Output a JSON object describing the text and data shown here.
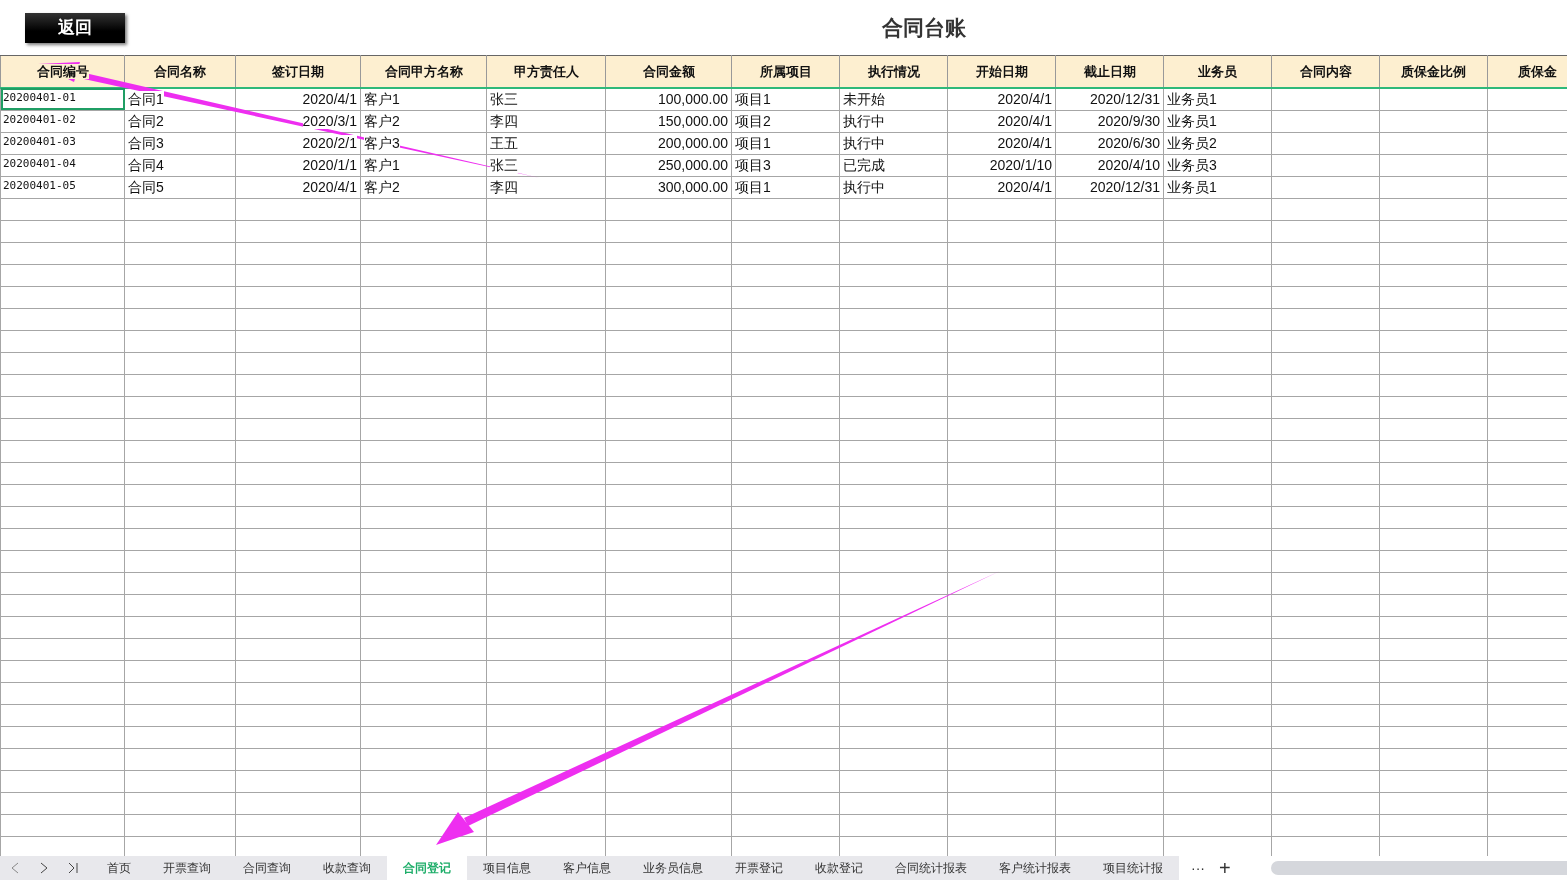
{
  "back_button": "返回",
  "title": "合同台账",
  "table": {
    "columns": [
      {
        "label": "合同编号",
        "kind": "code"
      },
      {
        "label": "合同名称",
        "kind": "text"
      },
      {
        "label": "签订日期",
        "kind": "number"
      },
      {
        "label": "合同甲方名称",
        "kind": "text"
      },
      {
        "label": "甲方责任人",
        "kind": "text"
      },
      {
        "label": "合同金额",
        "kind": "number"
      },
      {
        "label": "所属项目",
        "kind": "text"
      },
      {
        "label": "执行情况",
        "kind": "text"
      },
      {
        "label": "开始日期",
        "kind": "number"
      },
      {
        "label": "截止日期",
        "kind": "number"
      },
      {
        "label": "业务员",
        "kind": "text"
      },
      {
        "label": "合同内容",
        "kind": "text"
      },
      {
        "label": "质保金比例",
        "kind": "text"
      },
      {
        "label": "质保金",
        "kind": "text"
      }
    ],
    "rows": [
      {
        "first_cell_selected": true,
        "cells": [
          "20200401-01",
          "合同1",
          "2020/4/1",
          "客户1",
          "张三",
          "100,000.00",
          "项目1",
          "未开始",
          "2020/4/1",
          "2020/12/31",
          "业务员1"
        ]
      },
      {
        "first_cell_selected": false,
        "cells": [
          "20200401-02",
          "合同2",
          "2020/3/1",
          "客户2",
          "李四",
          "150,000.00",
          "项目2",
          "执行中",
          "2020/4/1",
          "2020/9/30",
          "业务员1"
        ]
      },
      {
        "first_cell_selected": false,
        "cells": [
          "20200401-03",
          "合同3",
          "2020/2/1",
          "客户3",
          "王五",
          "200,000.00",
          "项目1",
          "执行中",
          "2020/4/1",
          "2020/6/30",
          "业务员2"
        ]
      },
      {
        "first_cell_selected": false,
        "cells": [
          "20200401-04",
          "合同4",
          "2020/1/1",
          "客户1",
          "张三",
          "250,000.00",
          "项目3",
          "已完成",
          "2020/1/10",
          "2020/4/10",
          "业务员3"
        ]
      },
      {
        "first_cell_selected": false,
        "cells": [
          "20200401-05",
          "合同5",
          "2020/4/1",
          "客户2",
          "李四",
          "300,000.00",
          "项目1",
          "执行中",
          "2020/4/1",
          "2020/12/31",
          "业务员1"
        ]
      }
    ]
  },
  "sheet_tabs": [
    {
      "label": "首页",
      "selected": false
    },
    {
      "label": "开票查询",
      "selected": false
    },
    {
      "label": "合同查询",
      "selected": false
    },
    {
      "label": "收款查询",
      "selected": false
    },
    {
      "label": "合同登记",
      "selected": true
    },
    {
      "label": "项目信息",
      "selected": false
    },
    {
      "label": "客户信息",
      "selected": false
    },
    {
      "label": "业务员信息",
      "selected": false
    },
    {
      "label": "开票登记",
      "selected": false
    },
    {
      "label": "收款登记",
      "selected": false
    },
    {
      "label": "合同统计报表",
      "selected": false
    },
    {
      "label": "客户统计报表",
      "selected": false
    },
    {
      "label": "项目统计报",
      "selected": false
    }
  ],
  "more_tabs": "···",
  "add_sheet": "+"
}
